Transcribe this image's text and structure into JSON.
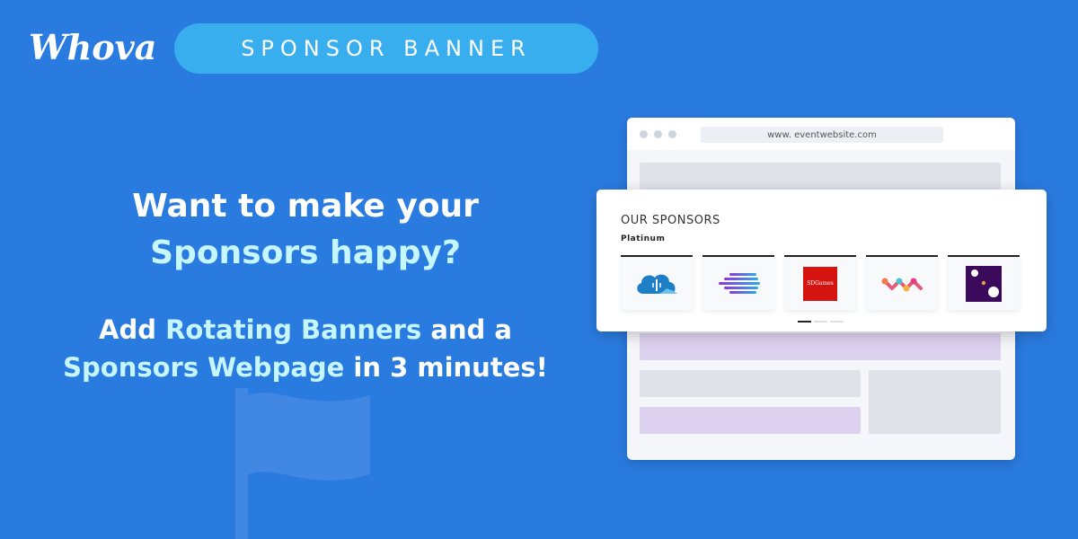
{
  "brand": {
    "logo": "Whova",
    "badge": "SPONSOR BANNER"
  },
  "headline": {
    "line1": "Want to make your",
    "line2": "Sponsors happy?",
    "line3_pre": "Add ",
    "line3_hl": "Rotating Banners",
    "line3_post": " and a",
    "line4_hl": "Sponsors Webpage",
    "line4_post": " in 3 minutes!"
  },
  "browser": {
    "url": "www. eventwebsite.com"
  },
  "sponsors_card": {
    "title": "OUR SPONSORS",
    "tier": "Platinum",
    "sponsors": [
      {
        "logo": "cloud-usb-icon"
      },
      {
        "logo": "speed-sphere-icon"
      },
      {
        "logo_text": "SDGames"
      },
      {
        "logo": "wave-dots-icon"
      },
      {
        "logo": "dots-square-icon"
      }
    ],
    "pager": {
      "pages": 3,
      "active": 1
    }
  },
  "colors": {
    "background": "#2a7be0",
    "badge": "#38aeee",
    "highlight": "#c6f6ff",
    "lavender": "#dcd1ef"
  }
}
